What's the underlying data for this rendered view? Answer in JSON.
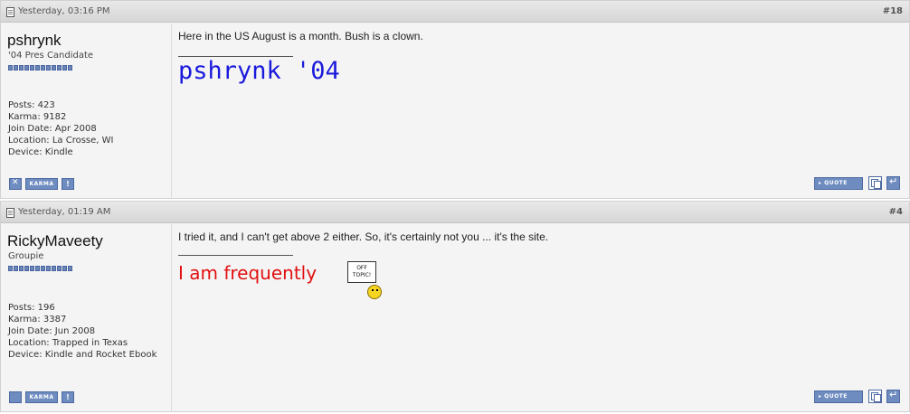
{
  "posts": [
    {
      "date": "Yesterday, 03:16 PM",
      "number": "#18",
      "username": "pshrynk",
      "user_title": "'04 Pres Candidate",
      "stats": [
        "Posts: 423",
        "Karma: 9182",
        "Join Date: Apr 2008",
        "Location: La Crosse, WI",
        "Device: Kindle"
      ],
      "message": "Here in the US August is a month. Bush is a clown.",
      "signature": "pshrynk '04",
      "karma_label": "KARMA",
      "report_label": "!",
      "quote_label": "▸ QUOTE"
    },
    {
      "date": "Yesterday, 01:19 AM",
      "number": "#4",
      "username": "RickyMaveety",
      "user_title": "Groupie",
      "stats": [
        "Posts: 196",
        "Karma: 3387",
        "Join Date: Jun 2008",
        "Location: Trapped in Texas",
        "Device: Kindle and Rocket Ebook"
      ],
      "message": "I tried it, and I can't get above 2 either. So, it's certainly not you ... it's the site.",
      "signature": "I am frequently",
      "sign_text": "OFF TOPIC!",
      "karma_label": "KARMA",
      "report_label": "!",
      "quote_label": "▸ QUOTE"
    }
  ],
  "colors": {
    "signature1": "#1a1adc",
    "signature2": "#e21010",
    "button": "#6e8cc0"
  }
}
